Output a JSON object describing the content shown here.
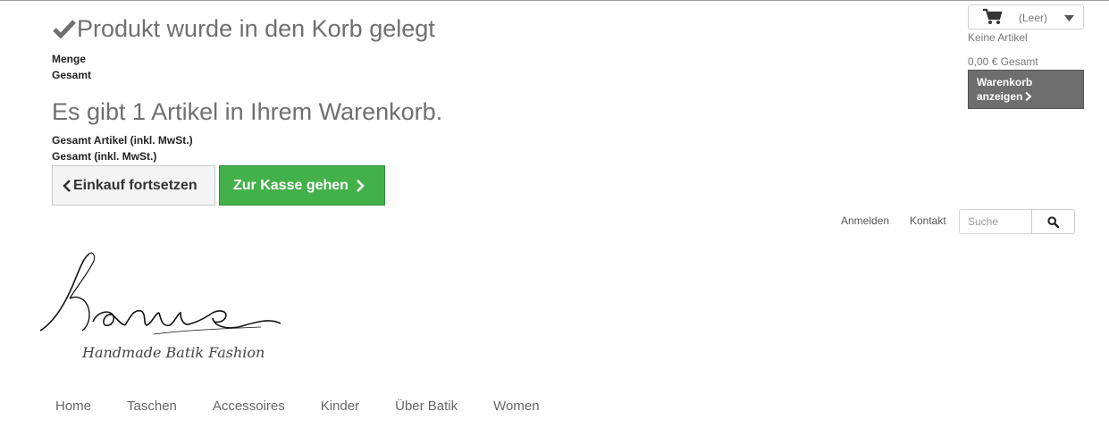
{
  "layer": {
    "title": "Produkt wurde in den Korb gelegt",
    "quantity_label": "Menge",
    "total_label": "Gesamt",
    "summary_title": "Es gibt 1 Artikel in Ihrem Warenkorb.",
    "total_products_label": "Gesamt Artikel (inkl. MwSt.)",
    "total_incl_label": "Gesamt (inkl. MwSt.)",
    "continue_label": "Einkauf fortsetzen",
    "checkout_label": "Zur Kasse gehen"
  },
  "cart": {
    "empty_label": "(Leer)",
    "no_items": "Keine Artikel",
    "total": "0,00 € Gesamt",
    "show_line1": "Warenkorb",
    "show_line2": "anzeigen"
  },
  "header": {
    "login": "Anmelden",
    "contact": "Kontakt",
    "search_placeholder": "Suche"
  },
  "logo": {
    "brand": "Kanue",
    "tagline": "Handmade Batik Fashion"
  },
  "menu": {
    "items": [
      "Home",
      "Taschen",
      "Accessoires",
      "Kinder",
      "Über Batik",
      "Women"
    ]
  },
  "colors": {
    "checkout_green": "#43b14a",
    "cart_button_gray": "#6e6e6e",
    "heading_gray": "#6f6f6f"
  },
  "icons": [
    "check-icon",
    "chevron-left-icon",
    "chevron-right-icon",
    "cart-icon",
    "caret-down-icon",
    "search-icon"
  ]
}
